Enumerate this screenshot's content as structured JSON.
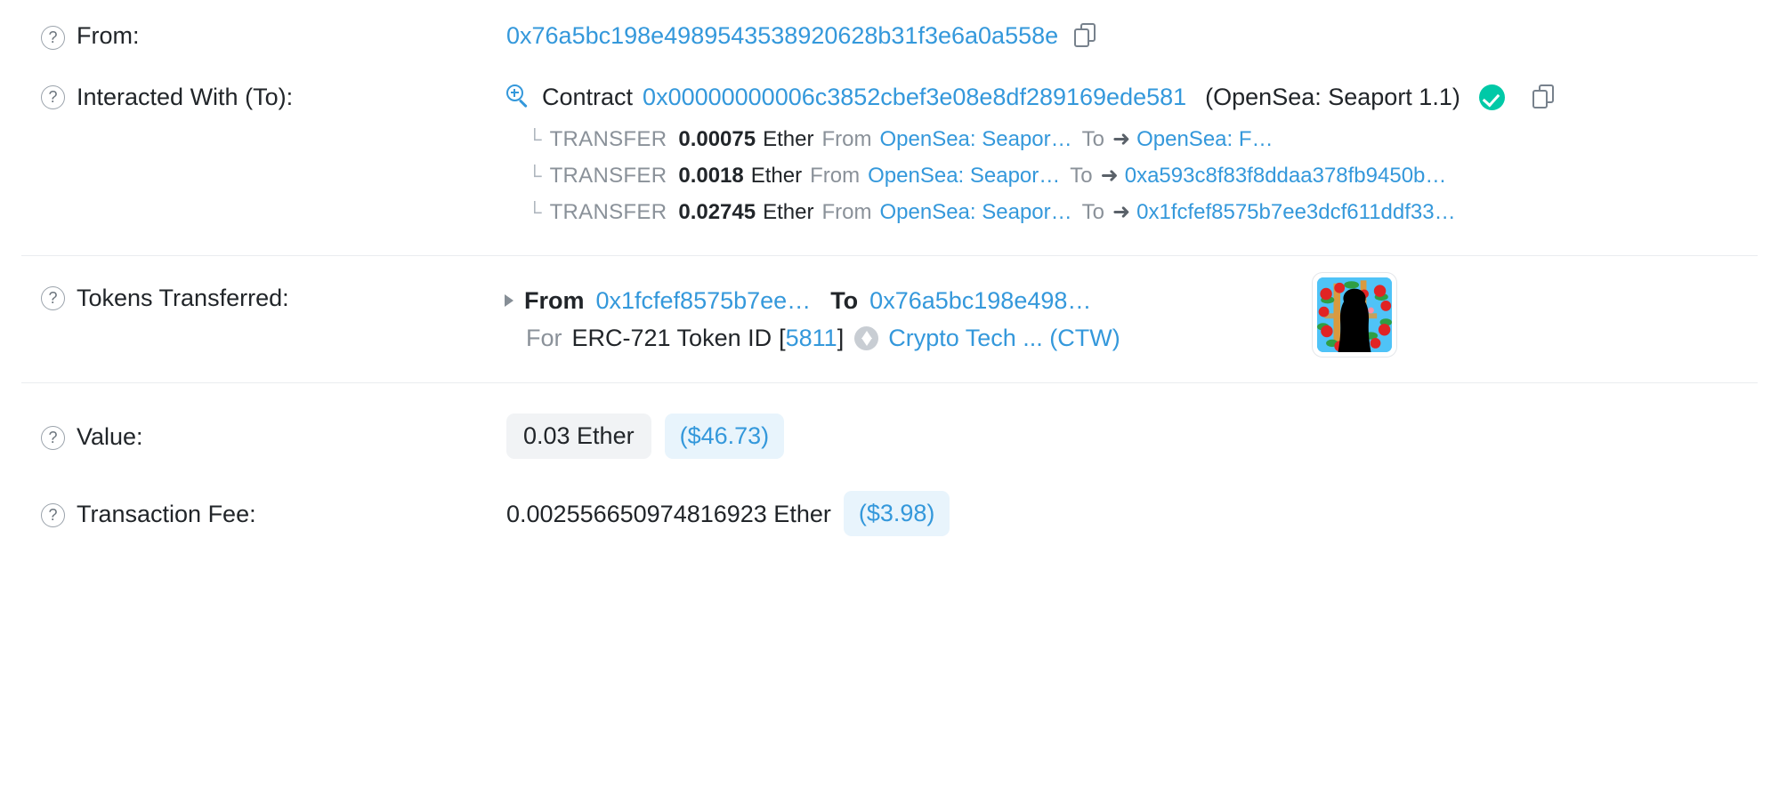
{
  "rows": {
    "from": {
      "label": "From:",
      "address": "0x76a5bc198e4989543538920628b31f3e6a0a558e"
    },
    "interacted_with": {
      "label": "Interacted With (To):",
      "contract_word": "Contract",
      "address": "0x00000000006c3852cbef3e08e8df289169ede581",
      "tag": "(OpenSea: Seaport 1.1)"
    },
    "tokens_transferred": {
      "label": "Tokens Transferred:",
      "from_word": "From",
      "from_address": "0x1fcfef8575b7ee…",
      "to_word": "To",
      "to_address": "0x76a5bc198e498…",
      "for_word": "For",
      "standard": "ERC-721 Token ID",
      "bracket_open": "[",
      "token_id": "5811",
      "bracket_close": "]",
      "token_name": "Crypto Tech ... (CTW)"
    },
    "value": {
      "label": "Value:",
      "ether": "0.03 Ether",
      "usd": "($46.73)"
    },
    "transaction_fee": {
      "label": "Transaction Fee:",
      "ether": "0.002556650974816923 Ether",
      "usd": "($3.98)"
    }
  },
  "internal_transfers": [
    {
      "elbow": "└",
      "kind": "TRANSFER",
      "amount": "0.00075",
      "unit": "Ether",
      "from_word": "From",
      "from_party": "OpenSea: Seapor…",
      "to_word": "To",
      "arrow": "➜",
      "to_party": "OpenSea: F…"
    },
    {
      "elbow": "└",
      "kind": "TRANSFER",
      "amount": "0.0018",
      "unit": "Ether",
      "from_word": "From",
      "from_party": "OpenSea: Seapor…",
      "to_word": "To",
      "arrow": "➜",
      "to_party": "0xa593c8f83f8ddaa378fb9450b…"
    },
    {
      "elbow": "└",
      "kind": "TRANSFER",
      "amount": "0.02745",
      "unit": "Ether",
      "from_word": "From",
      "from_party": "OpenSea: Seapor…",
      "to_word": "To",
      "arrow": "➜",
      "to_party": "0x1fcfef8575b7ee3dcf611ddf33…"
    }
  ],
  "colors": {
    "link_blue": "#3498db",
    "verified_green": "#00c9a7",
    "muted_gray": "#8a9199",
    "pill_gray_bg": "#f1f3f5",
    "pill_blue_bg": "#e8f4fc"
  },
  "icons": {
    "help": "?",
    "copy": "copy-icon",
    "search_plus": "search-plus-icon",
    "verified": "verified-check-icon",
    "eth_diamond": "ethereum-diamond-icon"
  }
}
